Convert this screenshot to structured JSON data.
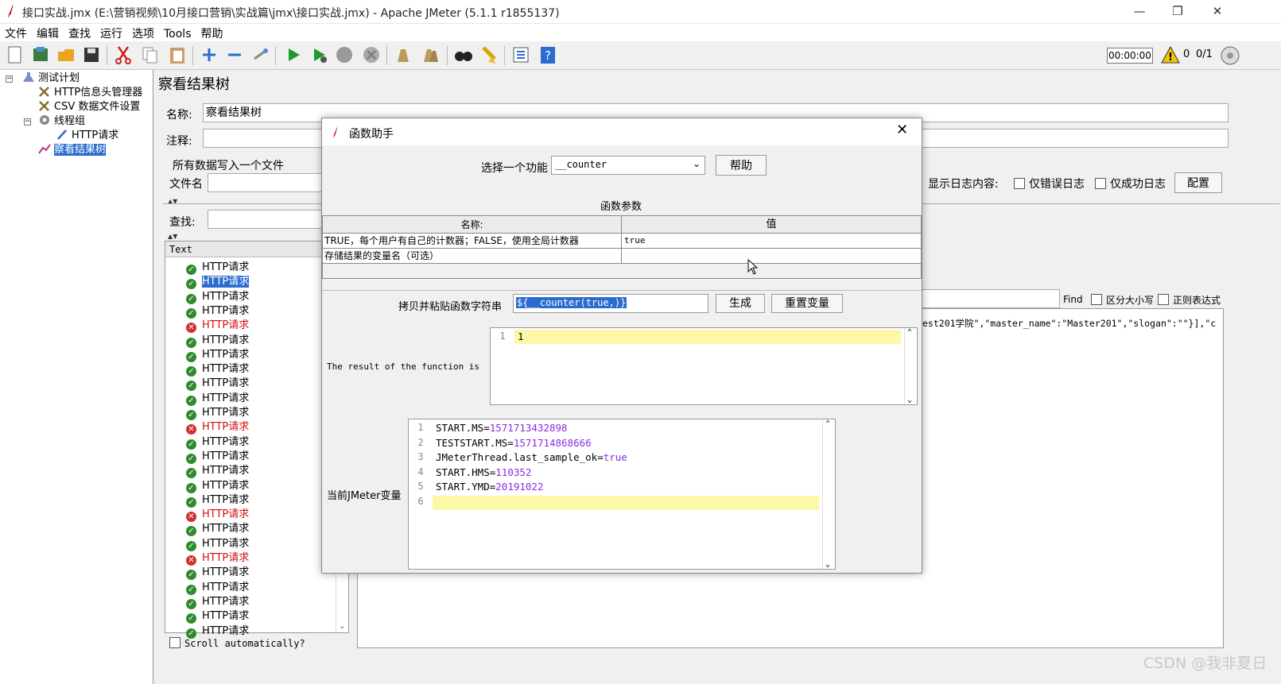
{
  "window": {
    "title": "接口实战.jmx (E:\\营销视频\\10月接口营销\\实战篇\\jmx\\接口实战.jmx) - Apache JMeter (5.1.1 r1855137)",
    "min_glyph": "—",
    "max_glyph": "❐",
    "close_glyph": "✕"
  },
  "menu": [
    "文件",
    "编辑",
    "查找",
    "运行",
    "选项",
    "Tools",
    "帮助"
  ],
  "toolbar_status": {
    "timer": "00:00:00",
    "warnings": "0",
    "threads": "0/1"
  },
  "tree": {
    "items": [
      {
        "label": "测试计划",
        "icon": "flask-icon"
      },
      {
        "label": "HTTP信息头管理器",
        "icon": "wrench-icon"
      },
      {
        "label": "CSV 数据文件设置",
        "icon": "wrench-icon"
      },
      {
        "label": "线程组",
        "icon": "gear-icon"
      },
      {
        "label": "HTTP请求",
        "icon": "pipette-icon"
      },
      {
        "label": "察看结果树",
        "icon": "chart-icon"
      }
    ]
  },
  "panel": {
    "title": "察看结果树",
    "name_label": "名称:",
    "name_value": "察看结果树",
    "comment_label": "注释:",
    "write_all_label": "所有数据写入一个文件",
    "file_label": "文件名",
    "show_log_label": "显示日志内容:",
    "errors_only": "仅错误日志",
    "success_only": "仅成功日志",
    "config_button": "配置",
    "search_label": "查找:",
    "list_header": "Text",
    "find_label": "Find",
    "case_label": "区分大小写",
    "regex_label": "正则表达式",
    "response_snippet": "est201学院\",\"master_name\":\"Master201\",\"slogan\":\"\"}],\"c",
    "scroll_auto": "Scroll automatically?"
  },
  "results": [
    {
      "label": "HTTP请求",
      "status": "ok"
    },
    {
      "label": "HTTP请求",
      "status": "ok",
      "selected": true
    },
    {
      "label": "HTTP请求",
      "status": "ok"
    },
    {
      "label": "HTTP请求",
      "status": "ok"
    },
    {
      "label": "HTTP请求",
      "status": "err"
    },
    {
      "label": "HTTP请求",
      "status": "ok"
    },
    {
      "label": "HTTP请求",
      "status": "ok"
    },
    {
      "label": "HTTP请求",
      "status": "ok"
    },
    {
      "label": "HTTP请求",
      "status": "ok"
    },
    {
      "label": "HTTP请求",
      "status": "ok"
    },
    {
      "label": "HTTP请求",
      "status": "ok"
    },
    {
      "label": "HTTP请求",
      "status": "err"
    },
    {
      "label": "HTTP请求",
      "status": "ok"
    },
    {
      "label": "HTTP请求",
      "status": "ok"
    },
    {
      "label": "HTTP请求",
      "status": "ok"
    },
    {
      "label": "HTTP请求",
      "status": "ok"
    },
    {
      "label": "HTTP请求",
      "status": "ok"
    },
    {
      "label": "HTTP请求",
      "status": "err"
    },
    {
      "label": "HTTP请求",
      "status": "ok"
    },
    {
      "label": "HTTP请求",
      "status": "ok"
    },
    {
      "label": "HTTP请求",
      "status": "err"
    },
    {
      "label": "HTTP请求",
      "status": "ok"
    },
    {
      "label": "HTTP请求",
      "status": "ok"
    },
    {
      "label": "HTTP请求",
      "status": "ok"
    },
    {
      "label": "HTTP请求",
      "status": "ok"
    },
    {
      "label": "HTTP请求",
      "status": "ok"
    }
  ],
  "dialog": {
    "title": "函数助手",
    "select_label": "选择一个功能",
    "function": "__counter",
    "help_button": "帮助",
    "params_title": "函数参数",
    "col_name": "名称:",
    "col_value": "值",
    "params": [
      {
        "name": "TRUE，每个用户有自己的计数器；FALSE，使用全局计数器",
        "value": "true"
      },
      {
        "name": "存储结果的变量名（可选）",
        "value": ""
      }
    ],
    "copy_label": "拷贝并粘贴函数字符串",
    "function_string": "${__counter(true,)}",
    "generate_button": "生成",
    "reset_button": "重置变量",
    "result_label": "The result of the function is",
    "result_lines": [
      "1"
    ],
    "vars_label": "当前JMeter变量",
    "vars": [
      {
        "key": "START.MS=",
        "val": "1571713432898"
      },
      {
        "key": "TESTSTART.MS=",
        "val": "1571714868666"
      },
      {
        "key": "JMeterThread.last_sample_ok=",
        "val": "true"
      },
      {
        "key": "START.HMS=",
        "val": "110352"
      },
      {
        "key": "START.YMD=",
        "val": "20191022"
      },
      {
        "key": "",
        "val": ""
      }
    ]
  },
  "watermark": "CSDN @我非夏日",
  "colors": {
    "selection": "#2a6ccf",
    "ok": "#2e8b2e",
    "error": "#d23030",
    "var_value": "#8a2be2",
    "highlight": "#fdf7a8"
  }
}
